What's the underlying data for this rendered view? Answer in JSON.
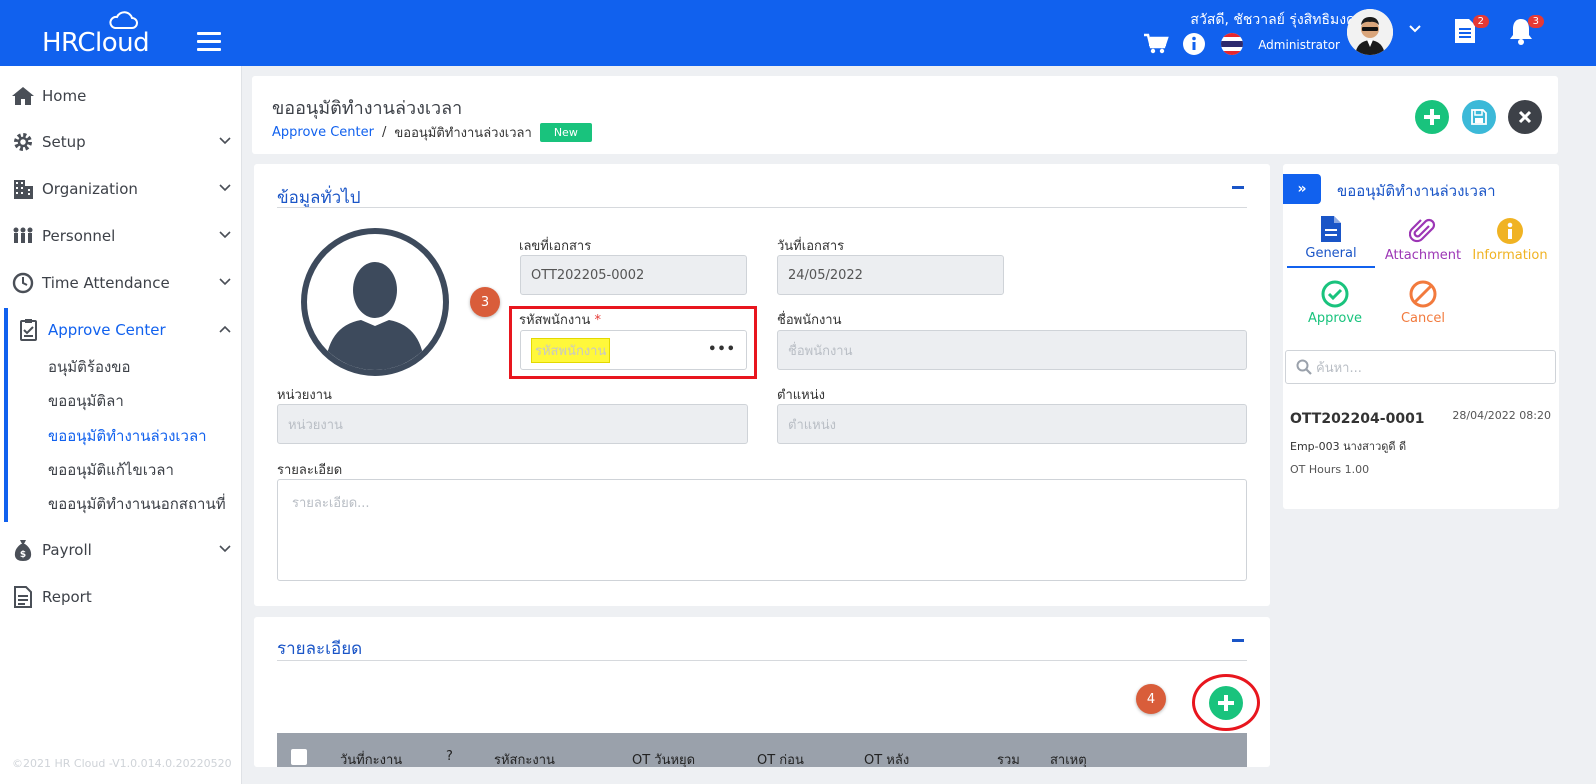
{
  "app": {
    "logo_text": "HRCloud"
  },
  "topbar": {
    "greeting": "สวัสดี, ชัชวาลย์ รุ่งสิทธิมงคล",
    "role": "Administrator",
    "doc_badge": "2",
    "bell_badge": "3"
  },
  "sidebar": {
    "items": [
      {
        "label": "Home"
      },
      {
        "label": "Setup"
      },
      {
        "label": "Organization"
      },
      {
        "label": "Personnel"
      },
      {
        "label": "Time Attendance"
      },
      {
        "label": "Approve Center"
      },
      {
        "label": "Payroll"
      },
      {
        "label": "Report"
      }
    ],
    "sub_items": [
      {
        "label": "อนุมัติร้องขอ"
      },
      {
        "label": "ขออนุมัติลา"
      },
      {
        "label": "ขออนุมัติทำงานล่วงเวลา"
      },
      {
        "label": "ขออนุมัติแก้ไขเวลา"
      },
      {
        "label": "ขออนุมัติทำงานนอกสถานที่"
      }
    ],
    "copyright": "©2021 HR Cloud -V1.0.014.0.20220520"
  },
  "header": {
    "title": "ขออนุมัติทำงานล่วงเวลา",
    "breadcrumb_link": "Approve Center",
    "breadcrumb_sep": "/",
    "breadcrumb_current": "ขออนุมัติทำงานล่วงเวลา",
    "status_badge": "New"
  },
  "general": {
    "section_title": "ข้อมูลทั่วไป",
    "doc_no_label": "เลขที่เอกสาร",
    "doc_no_value": "OTT202205-0002",
    "doc_date_label": "วันที่เอกสาร",
    "doc_date_value": "24/05/2022",
    "emp_code_label": "รหัสพนักงาน",
    "emp_code_required": "*",
    "emp_code_placeholder": "รหัสพนักงาน",
    "emp_code_dots": "•••",
    "emp_name_label": "ชื่อพนักงาน",
    "emp_name_placeholder": "ชื่อพนักงาน",
    "dept_label": "หน่วยงาน",
    "dept_placeholder": "หน่วยงาน",
    "position_label": "ตำแหน่ง",
    "position_placeholder": "ตำแหน่ง",
    "detail_label": "รายละเอียด",
    "detail_placeholder": "รายละเอียด...",
    "step_marker": "3"
  },
  "details": {
    "section_title": "รายละเอียด",
    "step_marker": "4",
    "columns": [
      "วันที่กะงาน",
      "?",
      "รหัสกะงาน",
      "OT วันหยุด",
      "OT ก่อน",
      "OT หลัง",
      "รวม",
      "สาเหตุ"
    ]
  },
  "right_panel": {
    "title": "ขออนุมัติทำงานล่วงเวลา",
    "tab_icon": "»",
    "actions": {
      "general": "General",
      "attachment": "Attachment",
      "information": "Information",
      "approve": "Approve",
      "cancel": "Cancel"
    },
    "search_placeholder": "ค้นหา...",
    "record": {
      "doc_no": "OTT202204-0001",
      "datetime": "28/04/2022 08:20",
      "employee": "Emp-003 นางสาวดูดี ดี",
      "hours": "OT Hours 1.00"
    }
  },
  "colors": {
    "primary": "#1161ee",
    "success": "#19c37d",
    "info": "#3cb9d8",
    "dark": "#3d4148",
    "danger": "#e8161e",
    "step": "#d95d3a"
  }
}
